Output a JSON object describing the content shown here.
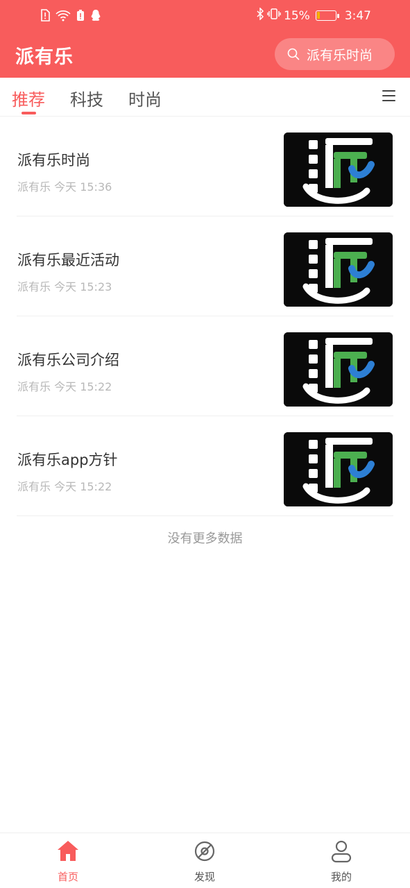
{
  "status_bar": {
    "battery": "15%",
    "battery_level": 0.15,
    "time": "3:47"
  },
  "header": {
    "title": "派有乐",
    "search_text": "派有乐时尚"
  },
  "tabs": [
    {
      "label": "推荐",
      "active": true
    },
    {
      "label": "科技",
      "active": false
    },
    {
      "label": "时尚",
      "active": false
    }
  ],
  "articles": [
    {
      "title": "派有乐时尚",
      "source": "派有乐",
      "time": "今天 15:36"
    },
    {
      "title": "派有乐最近活动",
      "source": "派有乐",
      "time": "今天 15:23"
    },
    {
      "title": "派有乐公司介绍",
      "source": "派有乐",
      "time": "今天 15:22"
    },
    {
      "title": "派有乐app方针",
      "source": "派有乐",
      "time": "今天 15:22"
    }
  ],
  "list_footer": "没有更多数据",
  "bottom_nav": [
    {
      "label": "首页",
      "icon": "home-icon",
      "active": true
    },
    {
      "label": "发现",
      "icon": "compass-icon",
      "active": false
    },
    {
      "label": "我的",
      "icon": "user-icon",
      "active": false
    }
  ],
  "colors": {
    "accent": "#f85c5c",
    "thumb_bg": "#0a0a0a",
    "logo_green": "#4caf50",
    "logo_blue": "#2d7fd4"
  }
}
